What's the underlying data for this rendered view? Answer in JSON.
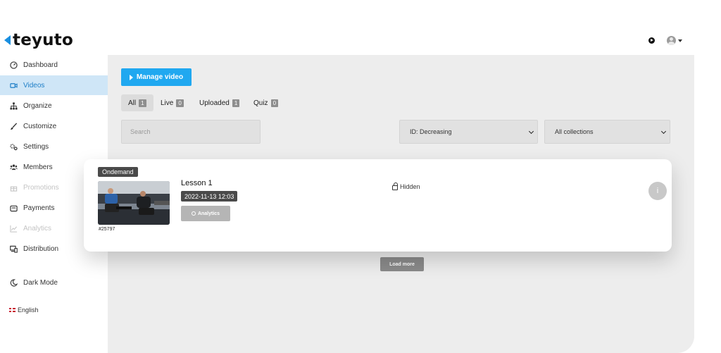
{
  "header": {
    "logo_text": "teyuto",
    "play_icon": "play-circle-icon",
    "avatar_icon": "user-avatar-icon"
  },
  "colors": {
    "accent": "#20a8f0",
    "brand": "#1a8fe0",
    "active_bg": "#cfe6f7",
    "main_bg": "#ededed"
  },
  "sidebar": {
    "items": [
      {
        "label": "Dashboard",
        "icon": "speedometer-icon"
      },
      {
        "label": "Videos",
        "icon": "video-camera-icon",
        "active": true
      },
      {
        "label": "Organize",
        "icon": "sitemap-icon"
      },
      {
        "label": "Customize",
        "icon": "brush-icon"
      },
      {
        "label": "Settings",
        "icon": "gears-icon"
      },
      {
        "label": "Members",
        "icon": "users-icon"
      },
      {
        "label": "Promotions",
        "icon": "gift-icon",
        "disabled": true
      },
      {
        "label": "Payments",
        "icon": "wallet-icon"
      },
      {
        "label": "Analytics",
        "icon": "chart-line-icon",
        "disabled": true
      },
      {
        "label": "Distribution",
        "icon": "devices-icon"
      }
    ],
    "dark_mode_label": "Dark Mode",
    "language_label": "English"
  },
  "main": {
    "manage_button_label": "Manage video",
    "tabs": [
      {
        "label": "All",
        "count": "1"
      },
      {
        "label": "Live",
        "count": "0"
      },
      {
        "label": "Uploaded",
        "count": "1"
      },
      {
        "label": "Quiz",
        "count": "0"
      }
    ],
    "search_placeholder": "Search",
    "sort_select_value": "ID: Decreasing",
    "collection_select_value": "All collections",
    "load_more_label": "Load more"
  },
  "video": {
    "type_badge": "Ondemand",
    "title": "Lesson 1",
    "date": "2022-11-13 12:03",
    "analytics_label": "Analytics",
    "status": "Hidden",
    "id": "#25797",
    "info_label": "i"
  }
}
